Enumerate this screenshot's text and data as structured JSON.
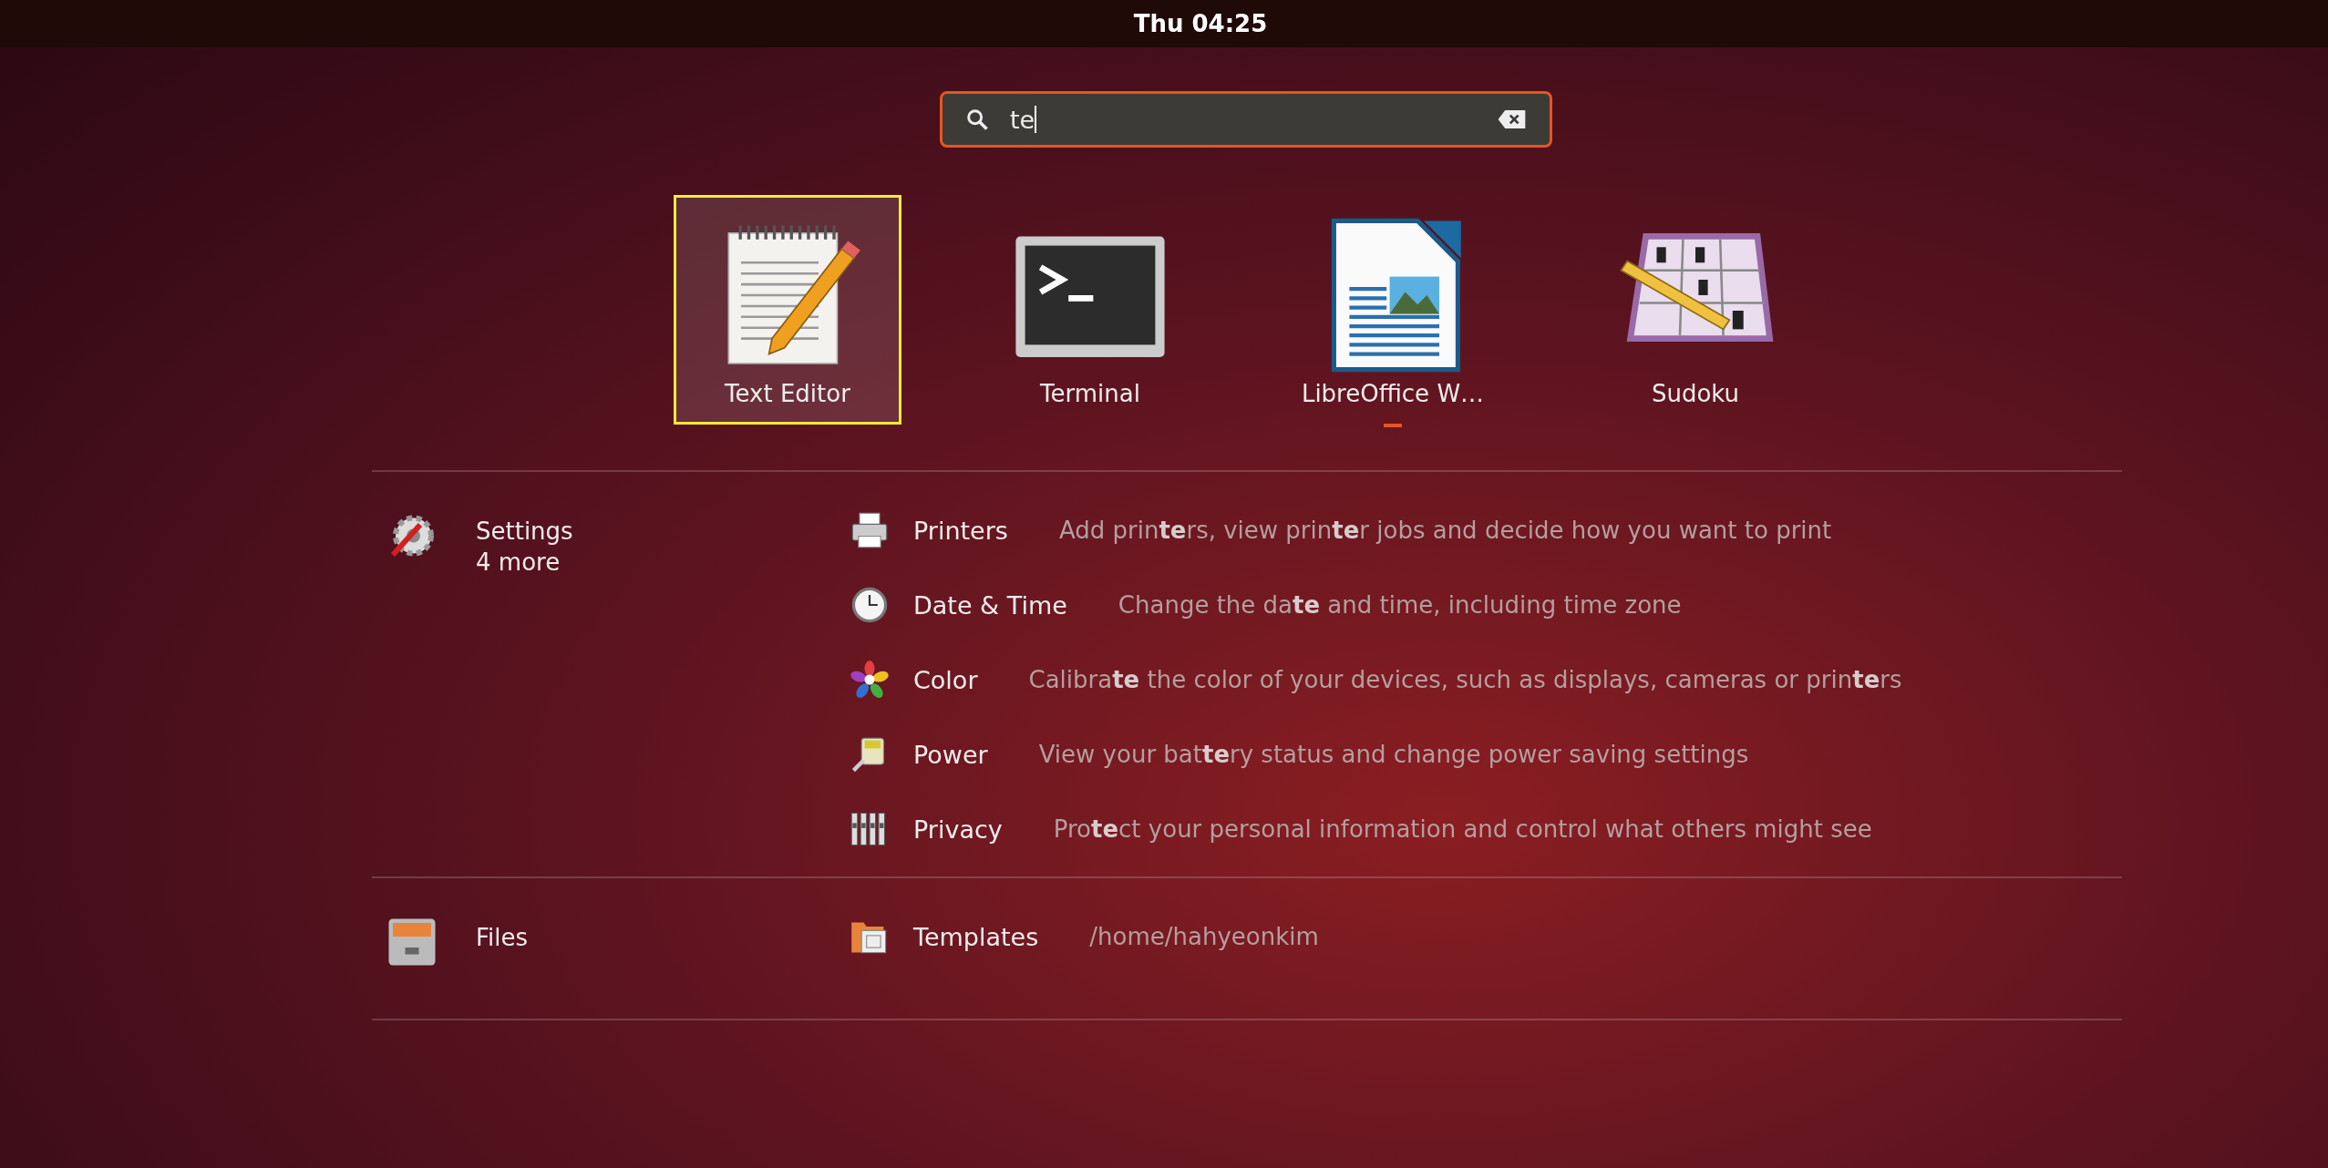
{
  "top_bar": {
    "clock": "Thu 04:25"
  },
  "search": {
    "value": "te"
  },
  "apps": [
    {
      "name": "Text Editor",
      "kind": "editor",
      "selected": true,
      "running": false
    },
    {
      "name": "Terminal",
      "kind": "terminal",
      "selected": false,
      "running": false
    },
    {
      "name": "LibreOffice W…",
      "kind": "writer",
      "selected": false,
      "running": true
    },
    {
      "name": "Sudoku",
      "kind": "sudoku",
      "selected": false,
      "running": false
    }
  ],
  "providers": [
    {
      "name": "Settings",
      "kind": "settings",
      "more": "4 more",
      "results": [
        {
          "name": "Printers",
          "kind": "printer",
          "description": "Add prin**te**rs, view prin**te**r jobs and decide how you want to print"
        },
        {
          "name": "Date & Time",
          "kind": "clock",
          "description": "Change the da**te** and time, including time zone"
        },
        {
          "name": "Color",
          "kind": "color",
          "description": "Calibra**te** the color of your devices, such as displays, cameras or prin**te**rs"
        },
        {
          "name": "Power",
          "kind": "power",
          "description": "View your bat**te**ry status and change power saving settings"
        },
        {
          "name": "Privacy",
          "kind": "privacy",
          "description": "Pro**te**ct your personal information and control what others might see"
        }
      ]
    },
    {
      "name": "Files",
      "kind": "files",
      "results": [
        {
          "name": "Templates",
          "kind": "folder",
          "description": "/home/hahyeonkim"
        }
      ]
    }
  ]
}
